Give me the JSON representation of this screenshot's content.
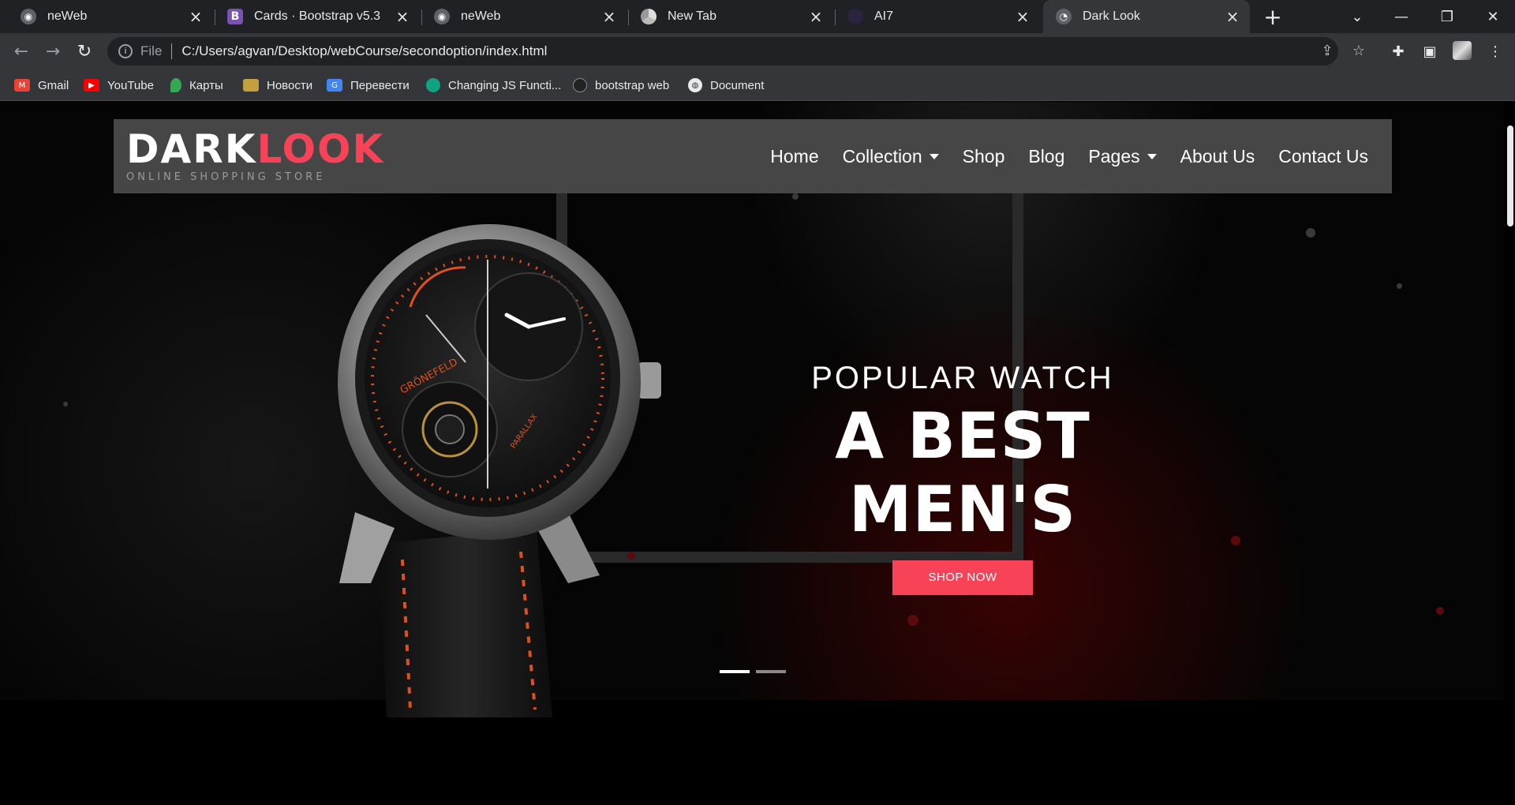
{
  "browser": {
    "tabs": [
      {
        "title": "neWeb",
        "icon": "globe-icon"
      },
      {
        "title": "Cards · Bootstrap v5.3",
        "icon": "bootstrap-icon"
      },
      {
        "title": "neWeb",
        "icon": "globe-icon"
      },
      {
        "title": "New Tab",
        "icon": "chrome-icon"
      },
      {
        "title": "AI7",
        "icon": "ai-icon"
      },
      {
        "title": "Dark Look",
        "icon": "page-icon",
        "active": true
      }
    ],
    "new_tab_glyph": "+",
    "address": {
      "scheme": "File",
      "url": "C:/Users/agvan/Desktop/webCourse/secondoption/index.html"
    },
    "bookmarks": [
      {
        "label": "Gmail",
        "icon": "gmail-icon"
      },
      {
        "label": "YouTube",
        "icon": "youtube-icon"
      },
      {
        "label": "Карты",
        "icon": "maps-icon"
      },
      {
        "label": "Новости",
        "icon": "news-icon"
      },
      {
        "label": "Перевести",
        "icon": "translate-icon"
      },
      {
        "label": "Changing JS Functi...",
        "icon": "chatgpt-icon"
      },
      {
        "label": "bootstrap web",
        "icon": "bootstrap-web-icon"
      },
      {
        "label": "Document",
        "icon": "globe-icon"
      }
    ]
  },
  "site": {
    "brand": {
      "dark": "DARK",
      "look": "LOOK",
      "tagline": "ONLINE SHOPPING STORE"
    },
    "nav": [
      {
        "label": "Home"
      },
      {
        "label": "Collection",
        "dropdown": true
      },
      {
        "label": "Shop"
      },
      {
        "label": "Blog"
      },
      {
        "label": "Pages",
        "dropdown": true
      },
      {
        "label": "About Us"
      },
      {
        "label": "Contact Us"
      }
    ],
    "hero": {
      "kicker": "POPULAR WATCH",
      "headline": "A BEST MEN'S",
      "cta": "SHOP NOW",
      "watch_brand": "GRÖNEFELD",
      "watch_text": "PARALLAX",
      "slides": 2,
      "active_slide": 1
    },
    "colors": {
      "accent": "#f74257",
      "navbar": "#464646",
      "background": "#000000"
    }
  }
}
